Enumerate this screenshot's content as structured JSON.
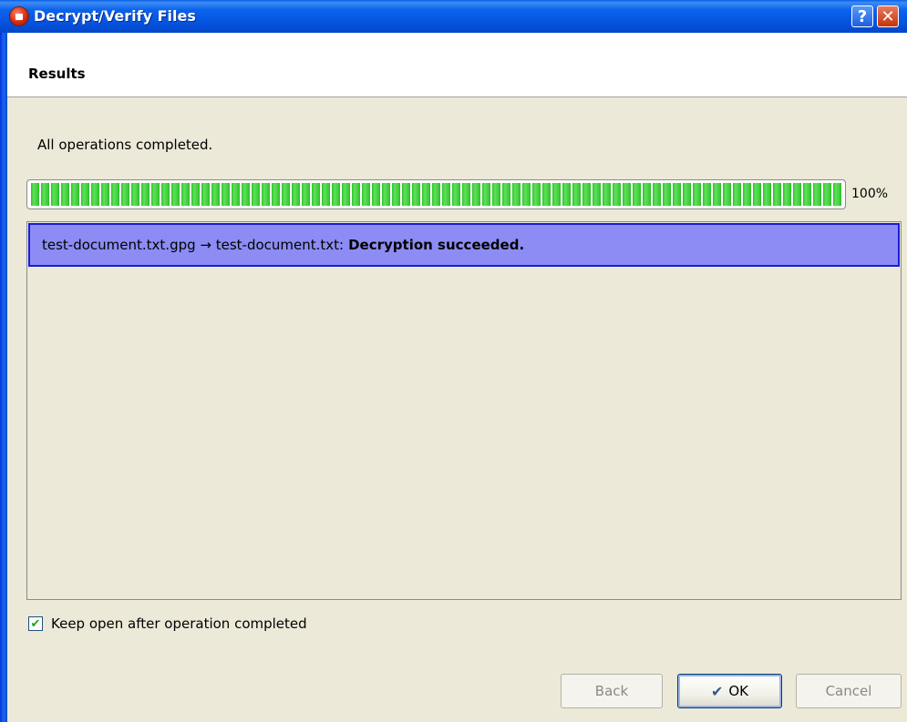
{
  "window": {
    "title": "Decrypt/Verify Files",
    "help_label": "?",
    "close_label": "✕"
  },
  "header": {
    "title": "Results"
  },
  "status": {
    "text": "All operations completed."
  },
  "progress": {
    "value": 100,
    "label": "100%"
  },
  "results": {
    "items": [
      {
        "text": "test-document.txt.gpg → test-document.txt:",
        "result": "Decryption succeeded.",
        "selected": true
      }
    ]
  },
  "keep_open": {
    "label": "Keep open after operation completed",
    "checked": true
  },
  "buttons": {
    "back": "Back",
    "ok": "OK",
    "cancel": "Cancel"
  },
  "colors": {
    "title_bar": "#0553df",
    "progress_fill": "#37c932",
    "selection": "#8c8cf4",
    "selection_border": "#1a1ad8"
  }
}
